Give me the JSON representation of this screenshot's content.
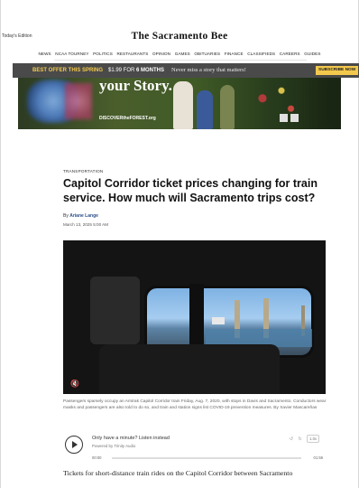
{
  "header": {
    "edition_label": "Today's Edition",
    "masthead": "The Sacramento Bee"
  },
  "nav": {
    "items": [
      "NEWS",
      "NCAA TOURNEY",
      "POLITICS",
      "RESTAURANTS",
      "OPINION",
      "GAMES",
      "OBITUARIES",
      "FINANCE",
      "CLASSIFIEDS",
      "CAREERS",
      "GUIDES"
    ]
  },
  "offer_bar": {
    "lead": "BEST OFFER THIS SPRING",
    "price_prefix": "$1.99 FOR ",
    "price_term": "6 MONTHS",
    "pitch": "Never miss a story that matters!",
    "subscribe_label": "SUBSCRIBE NOW",
    "colors": {
      "background": "#4a4a4a",
      "accent": "#f3c94d"
    }
  },
  "ad": {
    "headline": "your Story.",
    "tagline": "DISCOVERtheFOREST.org"
  },
  "article": {
    "kicker": "TRANSPORTATION",
    "headline": "Capitol Corridor ticket prices changing for train service. How much will Sacramento trips cost?",
    "byline_prefix": "By ",
    "author": "Ariane Lange",
    "date": "March 13, 2025 5:00 AM",
    "photo": {
      "mute_icon": "speaker-muted-icon"
    },
    "caption": "Passengers sparsely occupy an Amtrak Capitol Corridor train Friday, Aug. 7, 2020, with stops in Davis and Sacramento. Conductors wear masks and passengers are also told to do so, and train and station signs list COVID-19 prevention measures. By Xavier Mascareñas",
    "audio": {
      "title": "Only have a minute? Listen instead",
      "powered_by": "Powered by Trinity Audio",
      "speed": "1.0x",
      "time_start": "00:00",
      "time_end": "01:59",
      "progress": 0
    },
    "body_first_line": "Tickets for short-distance train rides on the Capitol Corridor between Sacramento"
  }
}
